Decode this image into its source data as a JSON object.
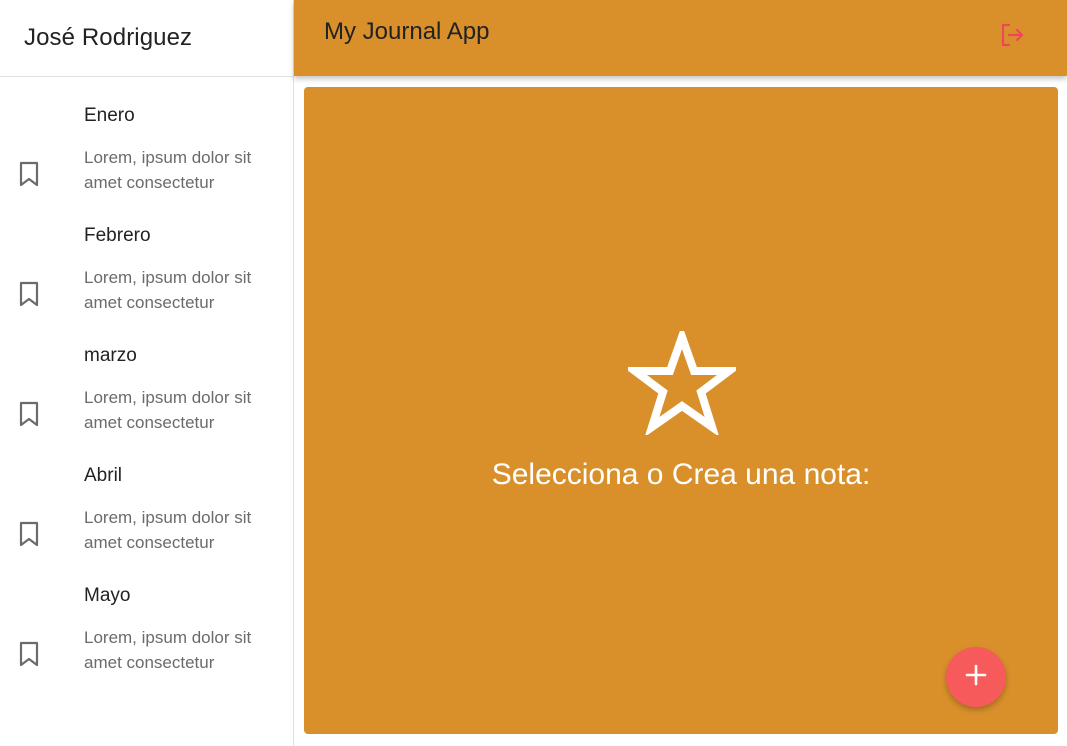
{
  "sidebar": {
    "user_name": "José Rodriguez",
    "items": [
      {
        "title": "Enero",
        "body": "Lorem, ipsum dolor sit amet consectetur",
        "icon": "bookmark-icon"
      },
      {
        "title": "Febrero",
        "body": "Lorem, ipsum dolor sit amet consectetur",
        "icon": "bookmark-icon"
      },
      {
        "title": "marzo",
        "body": "Lorem, ipsum dolor sit amet consectetur",
        "icon": "bookmark-icon"
      },
      {
        "title": "Abril",
        "body": "Lorem, ipsum dolor sit amet consectetur",
        "icon": "bookmark-icon"
      },
      {
        "title": "Mayo",
        "body": "Lorem, ipsum dolor sit amet consectetur",
        "icon": "bookmark-icon"
      }
    ]
  },
  "header": {
    "title": "My Journal App",
    "logout_icon": "logout-icon"
  },
  "main": {
    "empty_icon": "star-outline-icon",
    "empty_message": "Selecciona o Crea una nota:",
    "add_icon": "plus-icon"
  },
  "colors": {
    "primary": "#d9902b",
    "accent": "#f75a5a",
    "logout_icon": "#f0465a"
  }
}
